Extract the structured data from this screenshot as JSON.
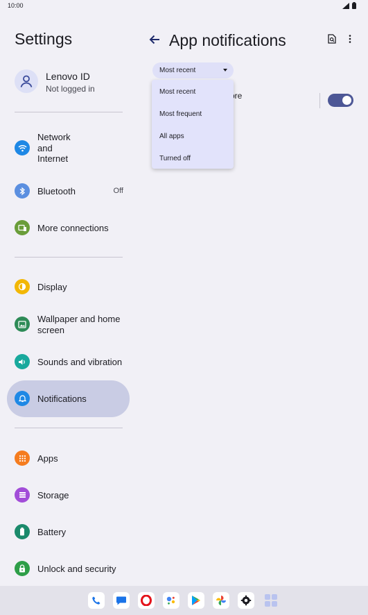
{
  "status_bar": {
    "time": "10:00",
    "icons": [
      "signal-icon",
      "battery-icon"
    ]
  },
  "settings": {
    "title": "Settings",
    "account": {
      "name": "Lenovo ID",
      "subtitle": "Not logged in",
      "icon": "person-icon"
    },
    "items": [
      {
        "id": "network",
        "label": "Network\nand\nInternet",
        "icon": "wifi-icon",
        "color": "#1e88e5"
      },
      {
        "id": "bluetooth",
        "label": "Bluetooth",
        "trailing": "Off",
        "icon": "bluetooth-icon",
        "color": "#5b8fe0"
      },
      {
        "id": "more-connections",
        "label": "More connections",
        "icon": "devices-icon",
        "color": "#6a9d3a"
      },
      {
        "id": "display",
        "label": "Display",
        "icon": "brightness-icon",
        "color": "#f2b705"
      },
      {
        "id": "wallpaper",
        "label": "Wallpaper and home\nscreen",
        "icon": "image-icon",
        "color": "#2e8b57"
      },
      {
        "id": "sounds",
        "label": "Sounds and vibration",
        "icon": "volume-icon",
        "color": "#19a99d"
      },
      {
        "id": "notifications",
        "label": "Notifications",
        "icon": "bell-icon",
        "color": "#1e88e5",
        "active": true
      },
      {
        "id": "apps",
        "label": "Apps",
        "icon": "apps-grid-icon",
        "color": "#f57c1f"
      },
      {
        "id": "storage",
        "label": "Storage",
        "icon": "storage-icon",
        "color": "#a24dd8"
      },
      {
        "id": "battery",
        "label": "Battery",
        "icon": "battery-icon",
        "color": "#1b8a6b"
      },
      {
        "id": "security",
        "label": "Unlock and security",
        "icon": "lock-icon",
        "color": "#2e9e48"
      }
    ]
  },
  "app_notifications": {
    "title": "App notifications",
    "sort_dropdown": {
      "selected": "Most recent"
    },
    "menu_options": [
      "Most recent",
      "Most frequent",
      "All apps",
      "Turned off"
    ],
    "row_partial_text": "ore",
    "toggle_on": true,
    "accent": "#4d5796"
  },
  "dock": {
    "apps": [
      "phone-icon",
      "messages-icon",
      "opera-icon",
      "assistant-icon",
      "play-store-icon",
      "photos-icon",
      "settings-gear-icon",
      "app-drawer-icon"
    ]
  }
}
